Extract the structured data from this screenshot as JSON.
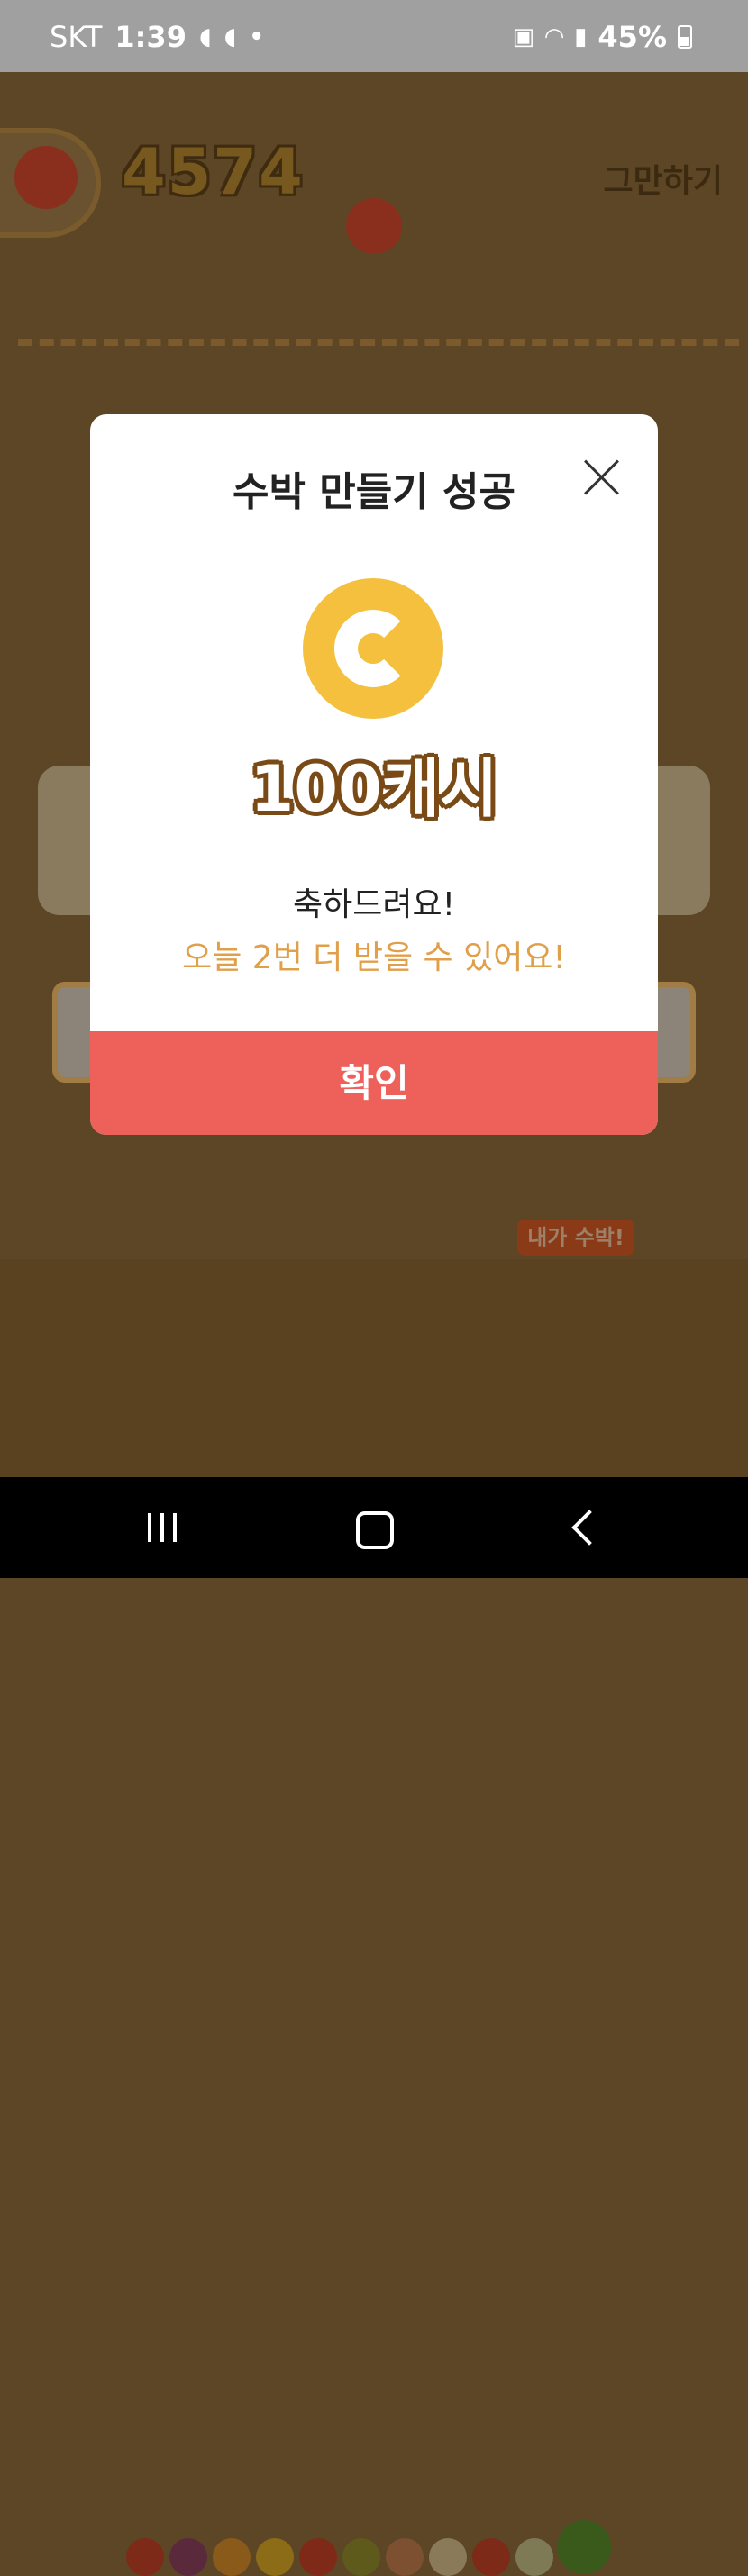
{
  "status_bar": {
    "carrier": "SKT",
    "time": "1:39",
    "battery": "45%",
    "icons": [
      "cashwalk-icon",
      "cashwalk-icon",
      "dot-icon",
      "battery-saver-icon",
      "wifi-icon",
      "signal-icon",
      "battery-icon"
    ]
  },
  "game": {
    "score": "4574",
    "quit_label": "그만하기",
    "my_watermelon_label": "내가 수박!"
  },
  "modal": {
    "title": "수박 만들기 성공",
    "reward_amount": "100캐시",
    "congrats_text": "축하드려요!",
    "remaining_text": "오늘 2번 더 받을 수 있어요!",
    "confirm_label": "확인",
    "colors": {
      "coin": "#f4c03e",
      "remaining_text": "#e0a04a",
      "confirm_button": "#ee615b"
    }
  },
  "nav_bar": {
    "icons": [
      "recent-apps-icon",
      "home-icon",
      "back-icon"
    ]
  }
}
